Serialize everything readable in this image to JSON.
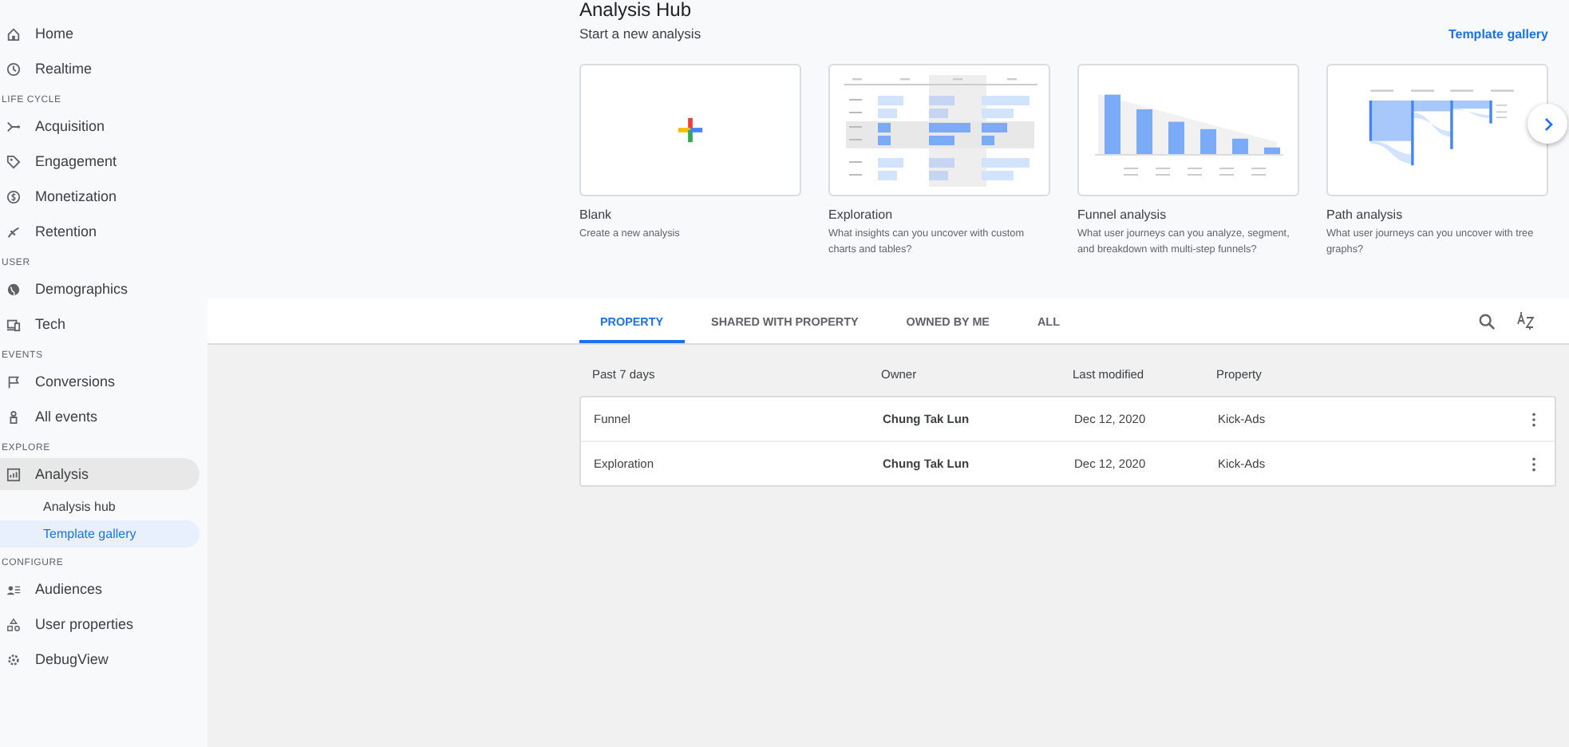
{
  "sidebar": {
    "sections": [
      {
        "items": [
          {
            "label": "Home",
            "selected": false,
            "expanded": false
          },
          {
            "label": "Realtime",
            "selected": false,
            "expanded": false
          }
        ]
      },
      {
        "heading": "LIFE CYCLE",
        "items": [
          {
            "label": "Acquisition",
            "selected": false,
            "expanded": false
          },
          {
            "label": "Engagement",
            "selected": false,
            "expanded": false
          },
          {
            "label": "Monetization",
            "selected": false,
            "expanded": false
          },
          {
            "label": "Retention",
            "selected": false,
            "expanded": false
          }
        ]
      },
      {
        "heading": "USER",
        "items": [
          {
            "label": "Demographics",
            "selected": false,
            "expanded": false
          },
          {
            "label": "Tech",
            "selected": false,
            "expanded": false
          }
        ]
      },
      {
        "heading": "EVENTS",
        "items": [
          {
            "label": "Conversions",
            "selected": false,
            "expanded": false
          },
          {
            "label": "All events",
            "selected": false,
            "expanded": false
          }
        ]
      },
      {
        "heading": "EXPLORE",
        "items": [
          {
            "label": "Analysis",
            "selected": false,
            "expanded": true,
            "children": [
              {
                "label": "Analysis hub",
                "selected": false
              },
              {
                "label": "Template gallery",
                "selected": true
              }
            ]
          }
        ]
      },
      {
        "heading": "CONFIGURE",
        "items": [
          {
            "label": "Audiences",
            "selected": false,
            "expanded": false
          },
          {
            "label": "User properties",
            "selected": false,
            "expanded": false
          },
          {
            "label": "DebugView",
            "selected": false,
            "expanded": false
          }
        ]
      }
    ]
  },
  "page_title": "Analysis Hub",
  "subtitle": "Start a new analysis",
  "gallery_link": "Template gallery",
  "templates": [
    {
      "kind": "blank",
      "title": "Blank",
      "description": "Create a new analysis"
    },
    {
      "kind": "exploration",
      "title": "Exploration",
      "description": "What insights can you uncover with custom charts and tables?"
    },
    {
      "kind": "funnel",
      "title": "Funnel analysis",
      "description": "What user journeys can you analyze, segment, and breakdown with multi-step funnels?"
    },
    {
      "kind": "path",
      "title": "Path analysis",
      "description": "What user journeys can you uncover with tree graphs?"
    }
  ],
  "tabs": [
    {
      "label": "PROPERTY",
      "selected": true
    },
    {
      "label": "SHARED WITH PROPERTY",
      "selected": false
    },
    {
      "label": "OWNED BY ME",
      "selected": false
    },
    {
      "label": "ALL",
      "selected": false
    }
  ],
  "table": {
    "columns": [
      "Past 7 days",
      "Owner",
      "Last modified",
      "Property"
    ],
    "rows": [
      {
        "cells": [
          "Funnel",
          "Chung Tak Lun",
          "Dec 12, 2020",
          "Kick-Ads"
        ]
      },
      {
        "cells": [
          "Exploration",
          "Chung Tak Lun",
          "Dec 12, 2020",
          "Kick-Ads"
        ]
      }
    ]
  }
}
